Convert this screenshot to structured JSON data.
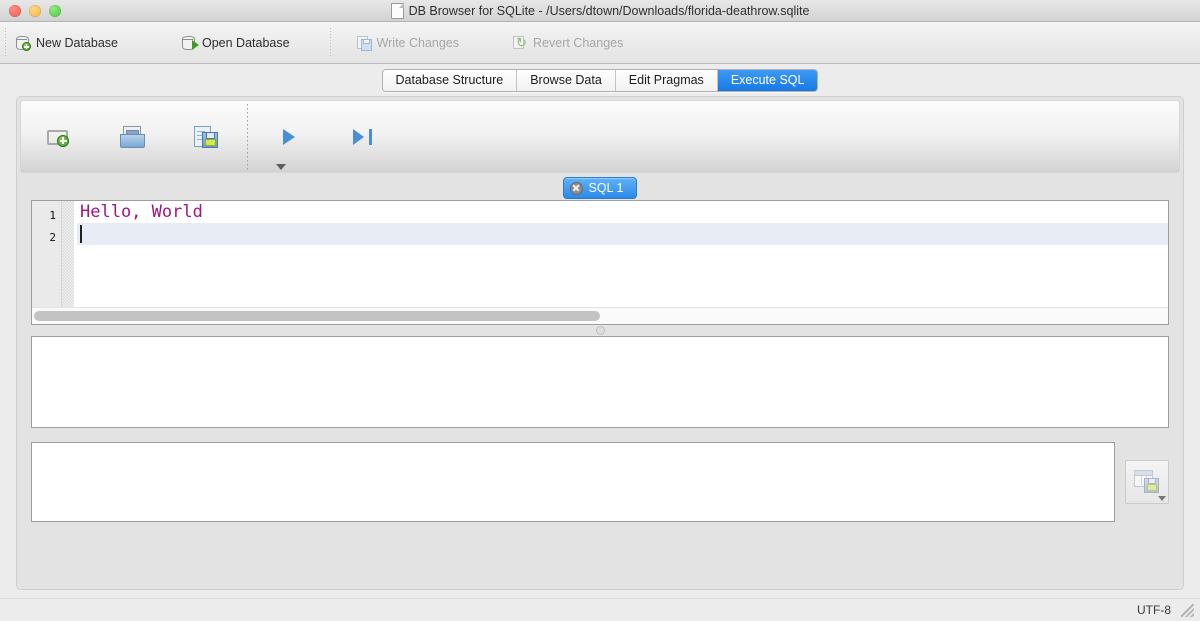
{
  "window": {
    "title": "DB Browser for SQLite - /Users/dtown/Downloads/florida-deathrow.sqlite",
    "controls": {
      "close": "close",
      "minimize": "minimize",
      "maximize": "maximize"
    }
  },
  "toolbar": {
    "items": [
      {
        "label": "New Database",
        "icon": "database-new-icon",
        "enabled": true
      },
      {
        "label": "Open Database",
        "icon": "database-open-icon",
        "enabled": true
      },
      {
        "label": "Write Changes",
        "icon": "write-changes-icon",
        "enabled": false
      },
      {
        "label": "Revert Changes",
        "icon": "revert-changes-icon",
        "enabled": false
      }
    ]
  },
  "tabs": {
    "items": [
      {
        "label": "Database Structure",
        "active": false
      },
      {
        "label": "Browse Data",
        "active": false
      },
      {
        "label": "Edit Pragmas",
        "active": false
      },
      {
        "label": "Execute SQL",
        "active": true
      }
    ],
    "active_color": "#1779e4"
  },
  "sql_toolbar": {
    "buttons": [
      {
        "name": "open-tab-button",
        "icon": "new-tab-icon"
      },
      {
        "name": "open-sql-file-button",
        "icon": "open-file-icon"
      },
      {
        "name": "save-sql-file-button",
        "icon": "save-file-icon"
      },
      {
        "name": "execute-all-button",
        "icon": "play-icon"
      },
      {
        "name": "execute-current-line-button",
        "icon": "play-to-line-icon"
      }
    ],
    "overflow": "toolbar-overflow-arrow"
  },
  "sql_tab": {
    "label": "SQL 1",
    "close": "close-tab-icon"
  },
  "editor": {
    "lines": [
      {
        "number": "1",
        "text": "Hello, World",
        "current": false
      },
      {
        "number": "2",
        "text": "",
        "current": true
      }
    ],
    "keyword_color": "#a0157d",
    "current_line_color": "#e8ecf5"
  },
  "results": {
    "grid_placeholder": "",
    "messages_placeholder": "",
    "save_results_button": "save-results-icon"
  },
  "statusbar": {
    "encoding": "UTF-8"
  }
}
